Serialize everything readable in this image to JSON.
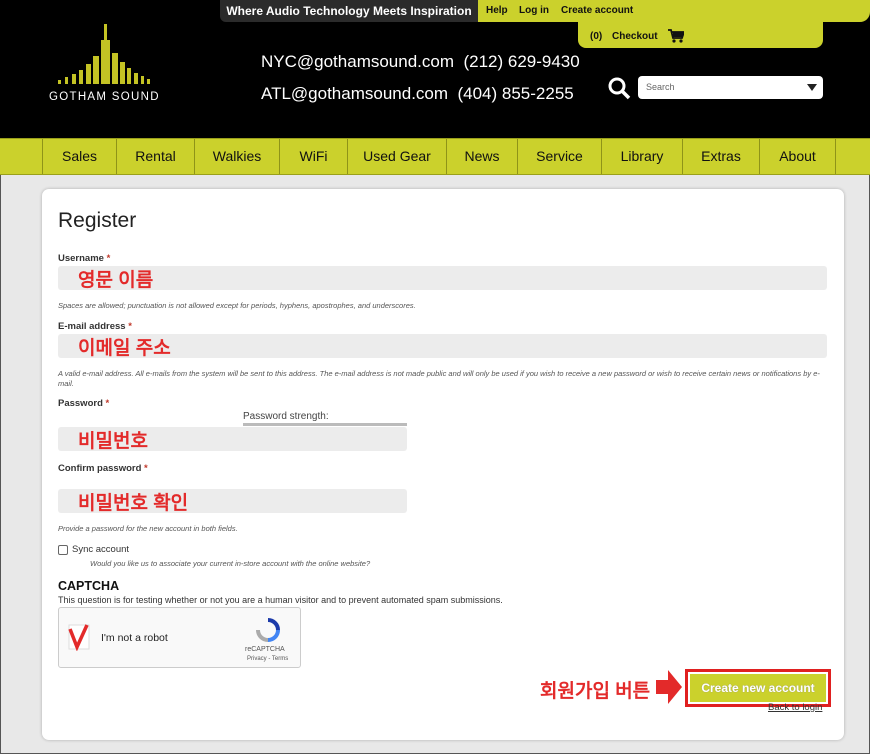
{
  "header": {
    "tagline": "Where Audio Technology Meets Inspiration",
    "top_links": {
      "help": "Help",
      "login": "Log in",
      "create": "Create account"
    },
    "cart": {
      "count": "(0)",
      "checkout": "Checkout"
    },
    "logo_text": "GOTHAM SOUND",
    "contact_line1": "NYC@gothamsound.com  (212) 629-9430",
    "contact_line2": "ATL@gothamsound.com  (404) 855-2255",
    "search_placeholder": "Search",
    "colors": {
      "accent": "#cbd12c",
      "background": "#000000"
    }
  },
  "nav": {
    "items": [
      "Sales",
      "Rental",
      "Walkies",
      "WiFi",
      "Used Gear",
      "News",
      "Service",
      "Library",
      "Extras",
      "About"
    ]
  },
  "form": {
    "title": "Register",
    "username": {
      "label": "Username",
      "required_mark": "*",
      "annotation": "영문 이름",
      "hint": "Spaces are allowed; punctuation is not allowed except for periods, hyphens, apostrophes, and underscores."
    },
    "email": {
      "label": "E-mail address",
      "required_mark": "*",
      "annotation": "이메일 주소",
      "hint": "A valid e-mail address. All e-mails from the system will be sent to this address. The e-mail address is not made public and will only be used if you wish to receive a new password or wish to receive certain news or notifications by e-mail."
    },
    "password": {
      "label": "Password",
      "required_mark": "*",
      "strength_label": "Password strength:",
      "annotation": "비밀번호"
    },
    "confirm_password": {
      "label": "Confirm password",
      "required_mark": "*",
      "annotation": "비밀번호 확인",
      "hint": "Provide a password for the new account in both fields."
    },
    "sync": {
      "label": "Sync account",
      "checked": false,
      "hint": "Would you like us to associate your current in-store account with the online website?"
    },
    "captcha": {
      "heading": "CAPTCHA",
      "description": "This question is for testing whether or not you are a human visitor and to prevent automated spam submissions.",
      "robot_label": "I'm not a robot",
      "brand": "reCAPTCHA",
      "links": "Privacy - Terms"
    },
    "submit": {
      "annotation": "회원가입 버튼",
      "label": "Create new account"
    },
    "back_to_login": "Back to login"
  }
}
